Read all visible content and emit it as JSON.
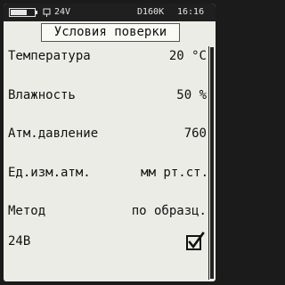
{
  "status_bar": {
    "battery_level": 0.7,
    "voltage": "24V",
    "device_id": "D160K",
    "time": "16:16"
  },
  "screen": {
    "title": "Условия поверки"
  },
  "rows": [
    {
      "label": "Температура",
      "value": "20 °C"
    },
    {
      "label": "Влажность",
      "value": "50 %"
    },
    {
      "label": "Атм.давление",
      "value": "760"
    },
    {
      "label": "Ед.изм.атм.",
      "value": "мм рт.ст."
    },
    {
      "label": "Метод",
      "value": "по образц."
    },
    {
      "label": "24В",
      "checked": true
    }
  ],
  "scroll": {
    "thumb_start": 0.0,
    "thumb_end": 1.0
  },
  "icons": {
    "battery": "battery-icon",
    "power": "power-plug-icon",
    "checkbox": "checkbox-checked-icon"
  },
  "colors": {
    "background": "#ecece6",
    "status_bar": "#1f1f1f",
    "text": "#111111"
  }
}
